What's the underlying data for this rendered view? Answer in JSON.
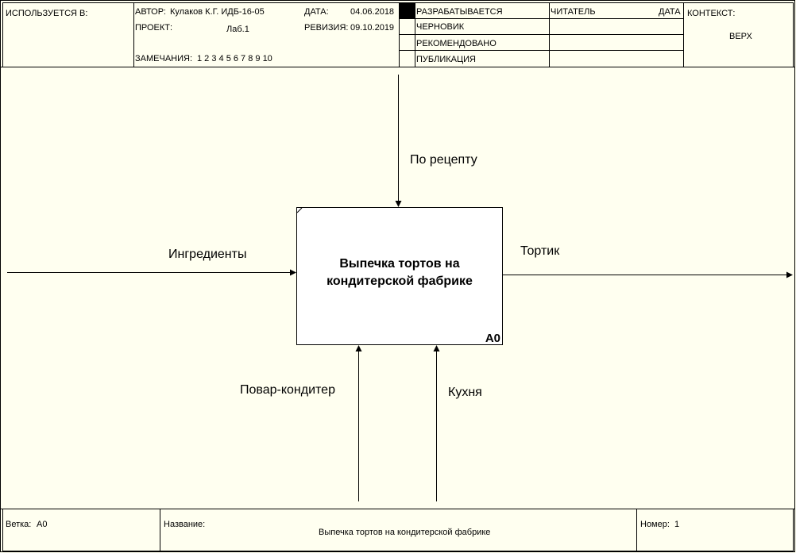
{
  "header": {
    "used_at": "ИСПОЛЬЗУЕТСЯ В:",
    "author_label": "АВТОР:",
    "author": "Кулаков К.Г. ИДБ-16-05",
    "project_label": "ПРОЕКТ:",
    "project": "Лаб.1",
    "notes_label": "ЗАМЕЧАНИЯ:",
    "notes": "1 2 3 4 5 6 7 8 9 10",
    "date_label": "ДАТА:",
    "date": "04.06.2018",
    "revision_label": "РЕВИЗИЯ:",
    "revision": "09.10.2019",
    "status": [
      "РАЗРАБАТЫВАЕТСЯ",
      "ЧЕРНОВИК",
      "РЕКОМЕНДОВАНО",
      "ПУБЛИКАЦИЯ"
    ],
    "reader_label": "ЧИТАТЕЛЬ",
    "reader_date_label": "ДАТА",
    "context_label": "КОНТЕКСТ:",
    "context": "ВЕРХ"
  },
  "diagram": {
    "activity_title": "Выпечка тортов на кондитерской фабрике",
    "activity_node": "A0",
    "arrows": {
      "control": "По рецепту",
      "input": "Ингредиенты",
      "output": "Тортик",
      "mechanism_1": "Повар-кондитер",
      "mechanism_2": "Кухня"
    }
  },
  "footer": {
    "node_label": "Ветка:",
    "node": "A0",
    "title_label": "Название:",
    "title": "Выпечка тортов на кондитерской фабрике",
    "number_label": "Номер:",
    "number": "1"
  }
}
